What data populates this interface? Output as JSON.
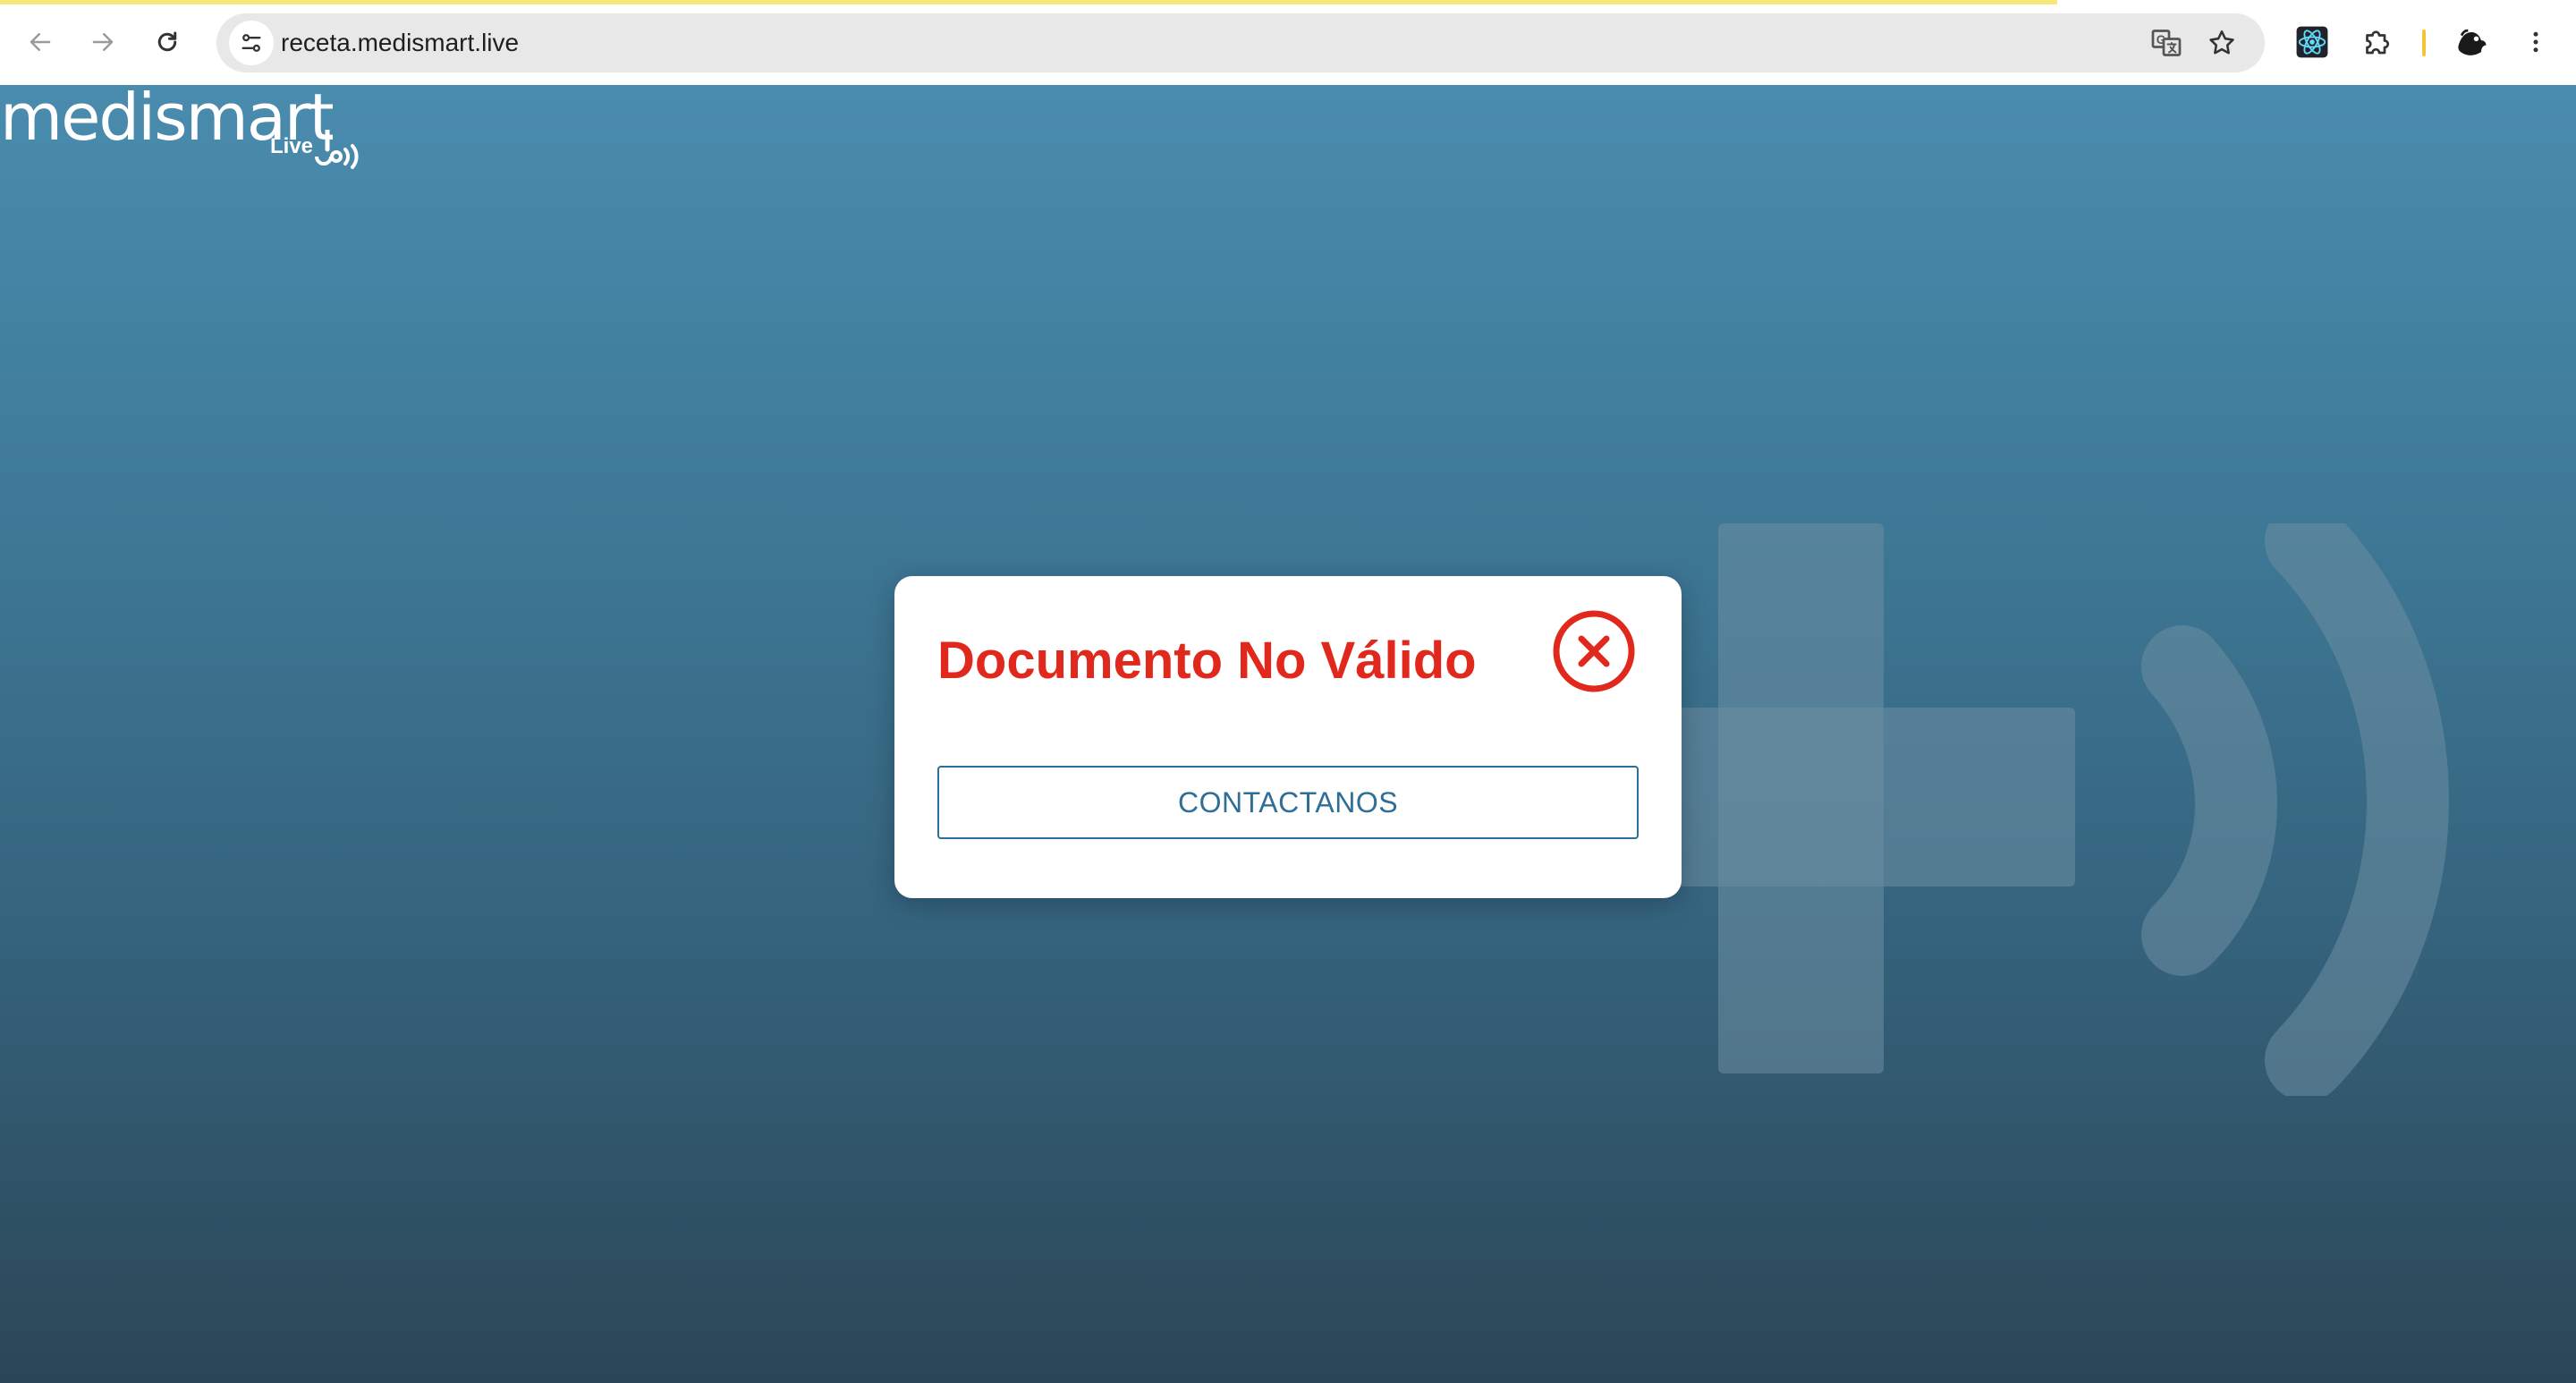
{
  "browser": {
    "url": "receta.medismart.live",
    "icons": {
      "back": "arrow-left-icon",
      "forward": "arrow-right-icon",
      "reload": "reload-icon",
      "site_info": "tune-icon",
      "translate": "translate-icon",
      "bookmark": "star-icon",
      "extension_react": "react-devtools-icon",
      "extensions": "puzzle-piece-icon",
      "profile": "profile-avatar",
      "menu": "kebab-menu-icon"
    },
    "progress_color": "#f7e87a"
  },
  "logo": {
    "word": "medismart",
    "sub": "Live"
  },
  "dialog": {
    "title": "Documento No Válido",
    "button_label": "CONTACTANOS",
    "title_color": "#e0281c",
    "button_color": "#2f6e96",
    "close_icon": "close-circle-icon"
  },
  "theme": {
    "gradient_top": "#4a8cae",
    "gradient_bottom": "#2b4656"
  }
}
